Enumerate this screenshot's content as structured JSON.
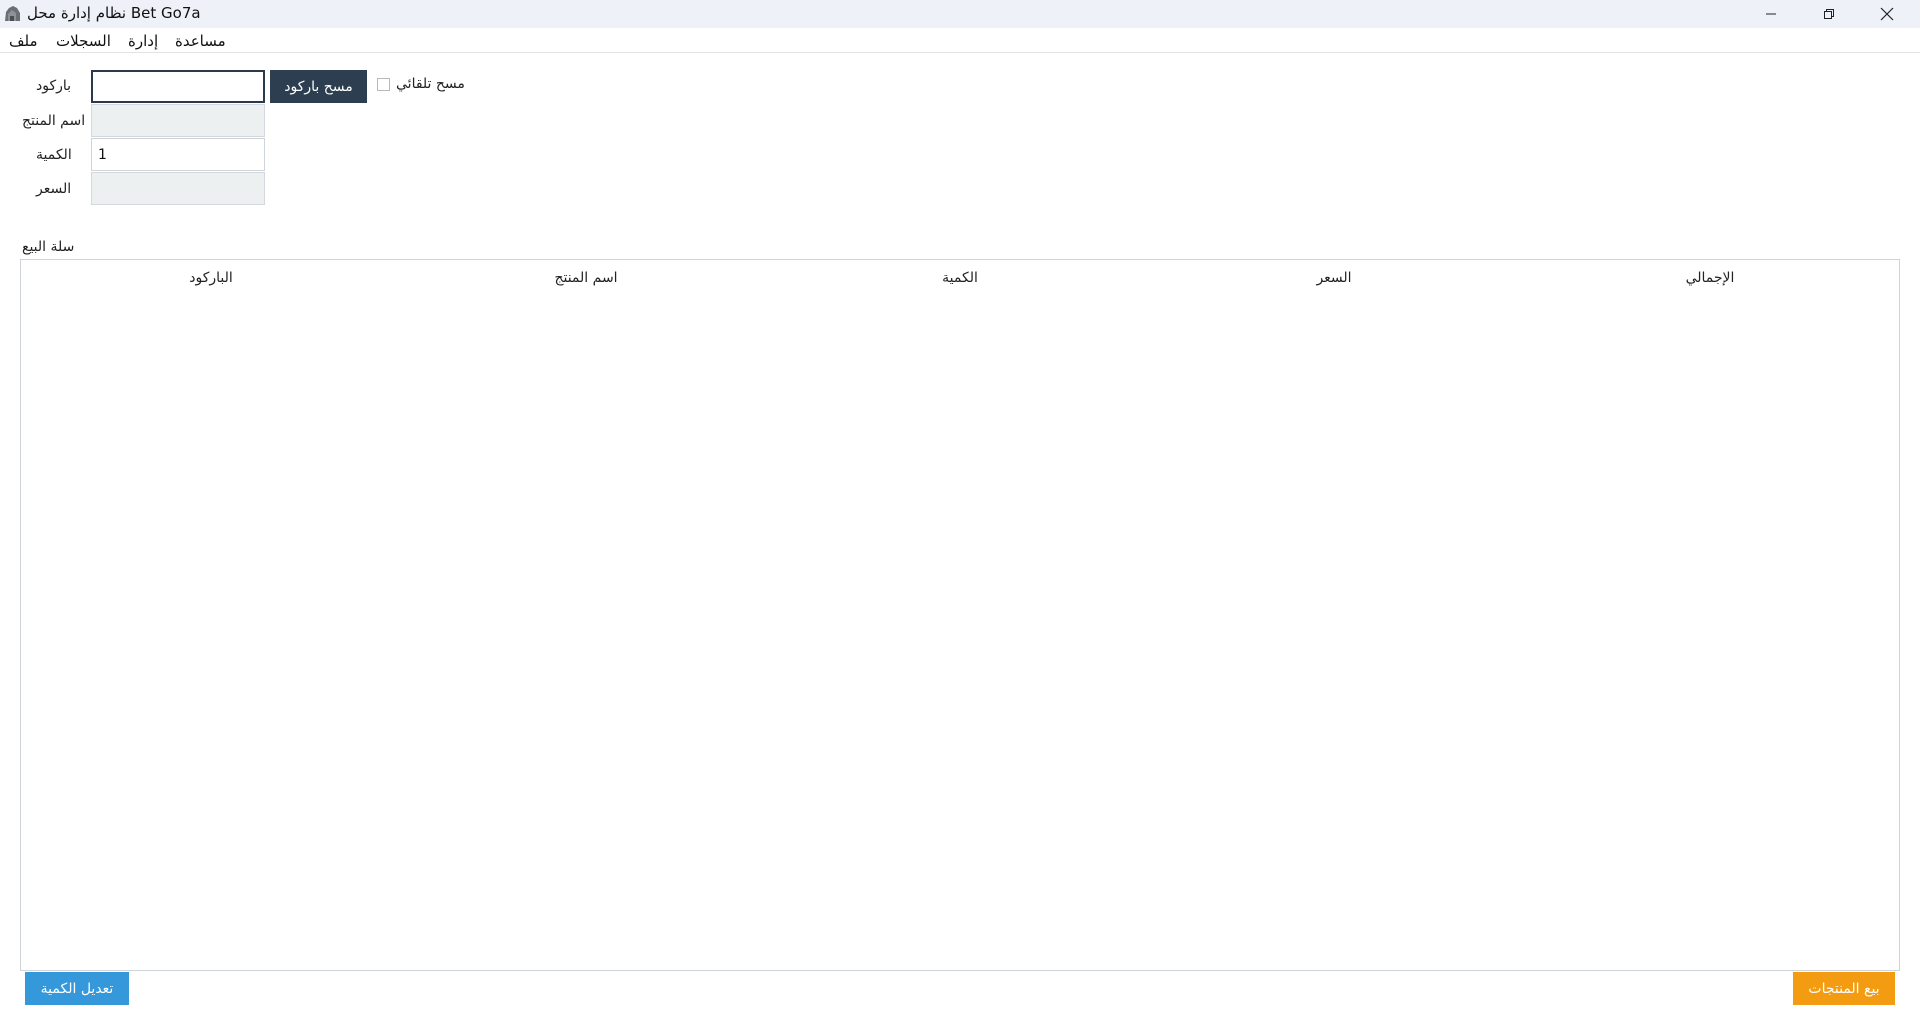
{
  "window": {
    "title": "نظام إدارة محل Bet Go7a",
    "controls": [
      "minimize-icon",
      "restore-icon",
      "close-icon"
    ]
  },
  "menu": {
    "file": "ملف",
    "records": "السجلات",
    "management": "إدارة",
    "help": "مساعدة"
  },
  "form": {
    "barcode_label": "باركود",
    "barcode_value": "",
    "product_name_label": "اسم المنتج",
    "product_name_value": "",
    "quantity_label": "الكمية",
    "quantity_value": "1",
    "price_label": "السعر",
    "price_value": "",
    "scan_button": "مسح باركود",
    "auto_scan_label": "مسح تلقائي",
    "auto_scan_checked": false
  },
  "cart": {
    "title": "سلة البيع",
    "columns": [
      "الباركود",
      "اسم المنتج",
      "الكمية",
      "السعر",
      "الإجمالي"
    ],
    "rows": []
  },
  "actions": {
    "edit_quantity": "تعديل الكمية",
    "sell_products": "بيع المنتجات"
  },
  "colors": {
    "scan_button": "#2c3e50",
    "edit_button": "#3498db",
    "sell_button": "#f39c12",
    "titlebar": "#eef1f7"
  }
}
